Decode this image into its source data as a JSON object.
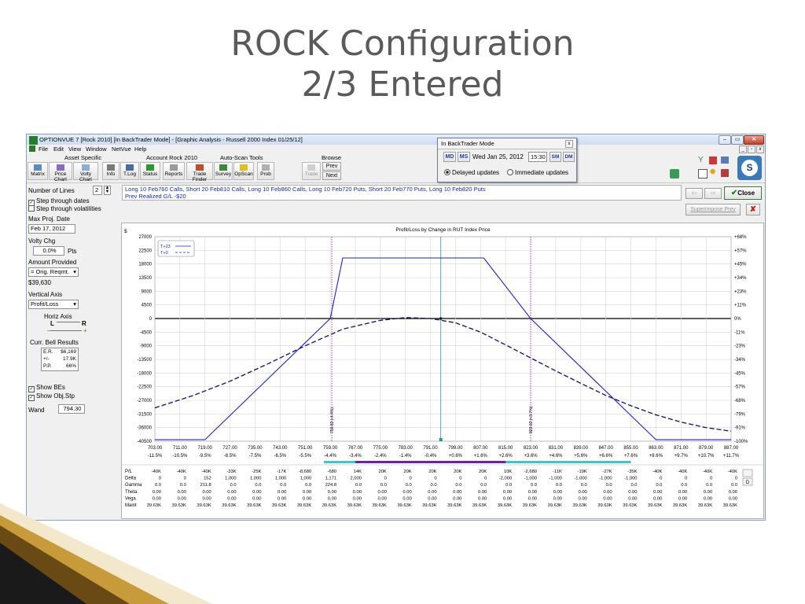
{
  "slide": {
    "title_line1": "ROCK Configuration",
    "title_line2": "2/3 Entered"
  },
  "window": {
    "title": "OPTIONVUE 7  [Rock 2010]  [In BackTrader Mode] - [Graphic Analysis - Russell 2000 Index  01/25/12]",
    "controls": {
      "minimize": "–",
      "maximize": "▭",
      "close": "✕"
    }
  },
  "menu": [
    "File",
    "Edit",
    "View",
    "Window",
    "NetVue",
    "Help"
  ],
  "toolbar": {
    "groups": {
      "asset": "Asset Specific",
      "account": "Account Rock 2010",
      "autoscan": "Auto-Scan Tools",
      "browse": "Browse"
    },
    "buttons": [
      "Matrix",
      "Price Chart",
      "Volty Chart",
      "Info",
      "T.Log",
      "Status",
      "Reports",
      "Trade Finder",
      "Survey",
      "OpScan",
      "Prob",
      "Trade"
    ],
    "browse_prev": "Prev",
    "browse_next": "Next"
  },
  "backtrader": {
    "title": "In BackTrader Mode",
    "date": "Wed Jan 25, 2012",
    "time": "15:30",
    "option_delayed": "Delayed updates",
    "option_immediate": "Immediate updates",
    "nav_labels": [
      "MD",
      "MS",
      "SM",
      "DM"
    ]
  },
  "left": {
    "number_of_lines_label": "Number of Lines",
    "number_of_lines": "2",
    "step_dates": "Step through dates",
    "step_vols": "Step through volatilities",
    "max_proj_label": "Max Proj. Date",
    "max_proj": "Feb 17, 2012",
    "volty_chg_label": "Volty Chg",
    "volty_chg": "0.0%",
    "pts": "Pts",
    "amount_label": "Amount Provided",
    "amount_select": "= Orig. Reqmt.",
    "amount_value": "$39,630",
    "vertical_axis_label": "Vertical Axis",
    "vertical_axis": "Profit/Loss",
    "horiz_axis_label": "Horiz Axis",
    "horiz_L": "L",
    "horiz_R": "R",
    "bell_label": "Curr. Bell Results",
    "bell_rows": [
      [
        "E.R.",
        "$6,169"
      ],
      [
        "+/-",
        "17.9K"
      ],
      [
        "P.P.",
        "66%"
      ]
    ],
    "show_bes": "Show BEs",
    "show_objstp": "Show Obj.Stp",
    "wand_label": "Wand",
    "wand_value": "794.30"
  },
  "position": {
    "line1": "Long 10 Feb760 Calls, Short 20 Feb810 Calls, Long 10 Feb860 Calls, Long 10 Feb720 Puts, Short 20 Feb770 Puts, Long 10 Feb820 Puts",
    "line2": "Prev Realized G/L -$20"
  },
  "right_buttons": {
    "close": "Close",
    "superimpose": "Superimpose Prev",
    "x": "✘"
  },
  "chart_data": {
    "type": "line",
    "title": "Profit/Loss by Change in RUT Index Price",
    "ylabel_unit": "$",
    "y_ticks": [
      27000,
      22500,
      18000,
      13500,
      9000,
      4500,
      0,
      -4500,
      -9000,
      -13500,
      -18000,
      -22500,
      -27000,
      -31500,
      -36000,
      -40500
    ],
    "y_tick_labels": [
      "27000",
      "22500",
      "18000",
      "13500",
      "9000",
      "4500",
      "0",
      "-4500",
      "-9000",
      "-13500",
      "-18000",
      "-22500",
      "-27000",
      "-31500",
      "-36000",
      "-40500"
    ],
    "right_ticks": [
      "+68%",
      "+57%",
      "+45%",
      "+34%",
      "+23%",
      "+11%",
      "0%",
      "-11%",
      "-23%",
      "-34%",
      "-45%",
      "-57%",
      "-68%",
      "-79%",
      "-91%",
      "-100%"
    ],
    "ylim": [
      -40500,
      27000
    ],
    "xlim": [
      703,
      887
    ],
    "x_ticks": [
      703,
      711,
      719,
      727,
      735,
      743,
      751,
      759,
      767,
      775,
      783,
      791,
      799,
      807,
      815,
      823,
      831,
      839,
      847,
      855,
      863,
      871,
      879,
      887
    ],
    "x_tick_labels": [
      "703.00",
      "711.00",
      "719.00",
      "727.00",
      "735.00",
      "743.00",
      "751.00",
      "759.00",
      "767.00",
      "775.00",
      "783.00",
      "791.00",
      "799.00",
      "807.00",
      "815.00",
      "823.00",
      "831.00",
      "839.00",
      "847.00",
      "855.00",
      "863.00",
      "871.00",
      "879.00",
      "887.00"
    ],
    "x_pct_labels": [
      "-11.5%",
      "-10.5%",
      "-9.5%",
      "-8.5%",
      "-7.5%",
      "-6.5%",
      "-5.5%",
      "-4.4%",
      "-3.4%",
      "-2.4%",
      "-1.4%",
      "-0.4%",
      "+0.6%",
      "+1.6%",
      "+2.6%",
      "+3.6%",
      "+4.6%",
      "+5.6%",
      "+6.6%",
      "+7.6%",
      "+8.6%",
      "+9.7%",
      "+10.7%",
      "+11.7%"
    ],
    "legend": [
      {
        "name": "T+23",
        "style": "solid"
      },
      {
        "name": "T+0",
        "style": "dashed"
      }
    ],
    "series": [
      {
        "name": "T+23",
        "style": "solid",
        "color": "#2020c8",
        "x": [
          703,
          719,
          759,
          763,
          808,
          823,
          863,
          887
        ],
        "y": [
          -40000,
          -40000,
          0,
          20000,
          20000,
          0,
          -40000,
          -40000
        ]
      },
      {
        "name": "T+0",
        "style": "dashed",
        "color": "#101060",
        "x": [
          703,
          715,
          727,
          739,
          751,
          763,
          775,
          783,
          791,
          799,
          807,
          815,
          823,
          831,
          839,
          847,
          855,
          863,
          871,
          879,
          887
        ],
        "y": [
          -29500,
          -25500,
          -20700,
          -15000,
          -9000,
          -3500,
          -600,
          300,
          0,
          -1400,
          -4500,
          -8700,
          -13000,
          -17300,
          -21400,
          -25400,
          -28800,
          -31800,
          -34200,
          -36000,
          -37200
        ]
      }
    ],
    "break_evens": [
      {
        "x": 759.5,
        "label": "759.82 (-4.4%)"
      },
      {
        "x": 823.0,
        "label": "823.02 (+3.7%)"
      }
    ],
    "current_price": 794.3,
    "grid": true
  },
  "table": {
    "row_labels": [
      "P/L",
      "Delta",
      "Gamma",
      "Theta",
      "Vega",
      "Maint"
    ],
    "rows": [
      [
        "-40K",
        "-40K",
        "-40K",
        "-33K",
        "-25K",
        "-17K",
        "-8,680",
        "-680",
        "14K",
        "20K",
        "20K",
        "20K",
        "20K",
        "20K",
        "10K",
        "-2,680",
        "-11K",
        "-19K",
        "-27K",
        "-35K",
        "-40K",
        "-40K",
        "-40K",
        "-40K"
      ],
      [
        "0",
        "0",
        "152",
        "1,000",
        "1,000",
        "1,000",
        "1,000",
        "1,171",
        "2,000",
        "0",
        "0",
        "0",
        "0",
        "0",
        "-2,000",
        "-1,000",
        "-1,000",
        "-1,000",
        "-1,000",
        "-1,000",
        "0",
        "0",
        "0",
        "0"
      ],
      [
        "0.0",
        "0.0",
        "211.8",
        "0.0",
        "0.0",
        "0.0",
        "0.0",
        "224.8",
        "0.0",
        "0.0",
        "0.0",
        "0.0",
        "0.0",
        "0.0",
        "0.0",
        "0.0",
        "0.0",
        "0.0",
        "0.0",
        "0.0",
        "0.0",
        "0.0",
        "0.0",
        "0.0"
      ],
      [
        "0.00",
        "0.00",
        "0.00",
        "0.00",
        "0.00",
        "0.00",
        "0.00",
        "0.00",
        "0.00",
        "0.00",
        "0.00",
        "0.00",
        "0.00",
        "0.00",
        "0.00",
        "0.00",
        "0.00",
        "0.00",
        "0.00",
        "0.00",
        "0.00",
        "0.00",
        "0.00",
        "0.00"
      ],
      [
        "0.00",
        "0.00",
        "0.00",
        "0.00",
        "0.00",
        "0.00",
        "0.00",
        "0.00",
        "0.00",
        "0.00",
        "0.00",
        "0.00",
        "0.00",
        "0.00",
        "0.00",
        "0.00",
        "0.00",
        "0.00",
        "0.00",
        "0.00",
        "0.00",
        "0.00",
        "0.00",
        "0.00"
      ],
      [
        "39.63K",
        "39.63K",
        "39.63K",
        "39.63K",
        "39.63K",
        "39.63K",
        "39.63K",
        "39.63K",
        "39.63K",
        "39.63K",
        "39.63K",
        "39.63K",
        "39.63K",
        "39.63K",
        "39.63K",
        "39.63K",
        "39.63K",
        "39.63K",
        "39.63K",
        "39.63K",
        "39.63K",
        "39.63K",
        "39.63K",
        "39.63K"
      ]
    ],
    "side_button": "D"
  },
  "colors": {
    "accent": "#2020c8",
    "breakeven": "#a020a0",
    "cyan_bar": "#3cc8c8",
    "purple_bar": "#7020a0",
    "close_green": "#1a8a1a"
  }
}
